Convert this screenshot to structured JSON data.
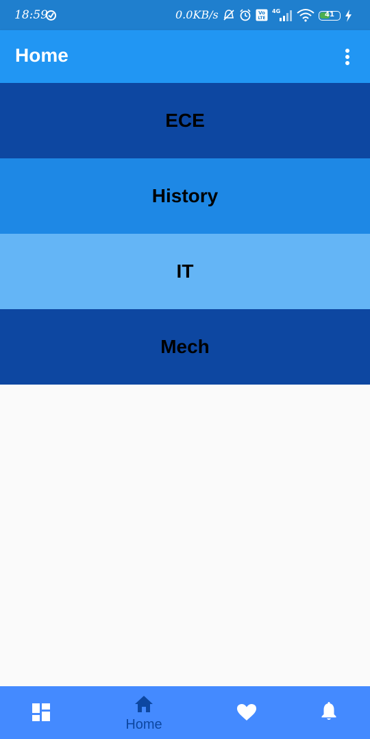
{
  "status_bar": {
    "time": "18:59",
    "network_speed": "0.0KB/s",
    "signal_type": "4G",
    "battery_level": "41",
    "volte_label": "Vo LTE"
  },
  "app_bar": {
    "title": "Home",
    "overflow_icon": "more-vert-icon"
  },
  "departments": [
    {
      "label": "ECE",
      "color": "#0d47a1"
    },
    {
      "label": "History",
      "color": "#1e88e5"
    },
    {
      "label": "IT",
      "color": "#64b5f6"
    },
    {
      "label": "Mech",
      "color": "#0d47a1"
    }
  ],
  "bottom_nav": {
    "items": [
      {
        "icon": "dashboard-icon",
        "label": ""
      },
      {
        "icon": "home-icon",
        "label": "Home",
        "selected": true
      },
      {
        "icon": "heart-icon",
        "label": ""
      },
      {
        "icon": "bell-icon",
        "label": ""
      }
    ],
    "background": "#448aff",
    "selected_color": "#0d47a1"
  }
}
